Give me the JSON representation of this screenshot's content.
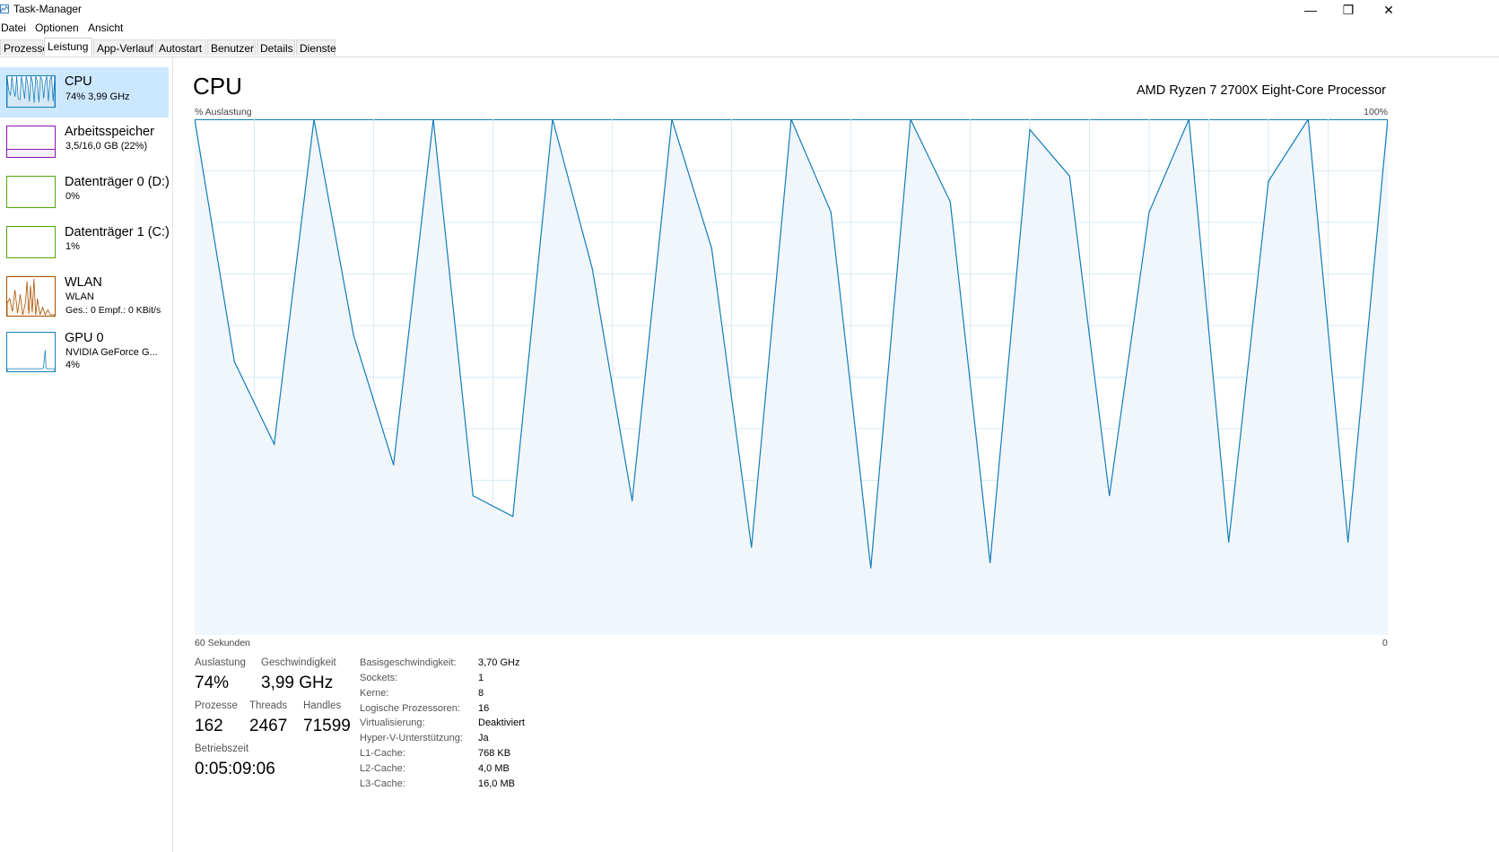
{
  "window": {
    "title": "Task-Manager",
    "minimize_glyph": "—",
    "restore_glyph": "❐",
    "close_glyph": "✕"
  },
  "menu": [
    "Datei",
    "Optionen",
    "Ansicht"
  ],
  "tabs": [
    "Prozesse",
    "Leistung",
    "App-Verlauf",
    "Autostart",
    "Benutzer",
    "Details",
    "Dienste"
  ],
  "active_tab": "Leistung",
  "sidebar": [
    {
      "title": "CPU",
      "subtitle": "74% 3,99 GHz",
      "subtitle2": "",
      "color": "#117dbb",
      "fill": "#f1f6fa",
      "selected": true
    },
    {
      "title": "Arbeitsspeicher",
      "subtitle": "3,5/16,0 GB (22%)",
      "subtitle2": "",
      "color": "#8b12ae",
      "fill": "#f4f0f5",
      "selected": false
    },
    {
      "title": "Datenträger 0 (D:)",
      "subtitle": "0%",
      "subtitle2": "",
      "color": "#4da60c",
      "fill": "#eff7eb",
      "selected": false
    },
    {
      "title": "Datenträger 1 (C:)",
      "subtitle": "1%",
      "subtitle2": "",
      "color": "#4da60c",
      "fill": "#eff7eb",
      "selected": false
    },
    {
      "title": "WLAN",
      "subtitle": "WLAN",
      "subtitle2": "Ges.: 0 Empf.: 0 KBit/s",
      "color": "#a74f01",
      "fill": "#fcf3eb",
      "selected": false
    },
    {
      "title": "GPU 0",
      "subtitle": "NVIDIA GeForce G...",
      "subtitle2": "4%",
      "color": "#1581bd",
      "fill": "#f1f6fa",
      "selected": false
    }
  ],
  "main": {
    "title": "CPU",
    "processor": "AMD Ryzen 7 2700X Eight-Core Processor",
    "graph_label_left": "% Auslastung",
    "graph_label_right": "100%",
    "time_label_left": "60 Sekunden",
    "time_label_right": "0"
  },
  "stats": {
    "utilization_label": "Auslastung",
    "utilization": "74%",
    "speed_label": "Geschwindigkeit",
    "speed": "3,99 GHz",
    "processes_label": "Prozesse",
    "processes": "162",
    "threads_label": "Threads",
    "threads": "2467",
    "handles_label": "Handles",
    "handles": "71599",
    "uptime_label": "Betriebszeit",
    "uptime": "0:05:09:06"
  },
  "details": [
    {
      "key": "Basisgeschwindigkeit:",
      "value": "3,70 GHz"
    },
    {
      "key": "Sockets:",
      "value": "1"
    },
    {
      "key": "Kerne:",
      "value": "8"
    },
    {
      "key": "Logische Prozessoren:",
      "value": "16"
    },
    {
      "key": "Virtualisierung:",
      "value": "Deaktiviert"
    },
    {
      "key": "Hyper-V-Unterstützung:",
      "value": "Ja"
    },
    {
      "key": "L1-Cache:",
      "value": "768 KB"
    },
    {
      "key": "L2-Cache:",
      "value": "4,0 MB"
    },
    {
      "key": "L3-Cache:",
      "value": "16,0 MB"
    }
  ],
  "chart_data": {
    "type": "area",
    "title": "CPU",
    "ylabel": "% Auslastung",
    "ylim": [
      0,
      100
    ],
    "xlabel": "60 Sekunden",
    "x_unit": "seconds ago",
    "x": [
      60,
      58,
      56,
      54,
      52,
      50,
      48,
      46,
      44,
      42,
      40,
      38,
      36,
      34,
      32,
      30,
      28,
      26,
      24,
      22,
      20,
      18,
      16,
      14,
      12,
      10,
      8,
      6,
      4,
      2,
      0
    ],
    "values": [
      100,
      53,
      37,
      100,
      58,
      33,
      100,
      27,
      23,
      100,
      71,
      26,
      100,
      75,
      17,
      100,
      82,
      13,
      100,
      84,
      14,
      98,
      89,
      27,
      82,
      100,
      18,
      88,
      100,
      18,
      100
    ],
    "color": "#117dbb",
    "fill": "#f1f6fa",
    "grid": true
  }
}
